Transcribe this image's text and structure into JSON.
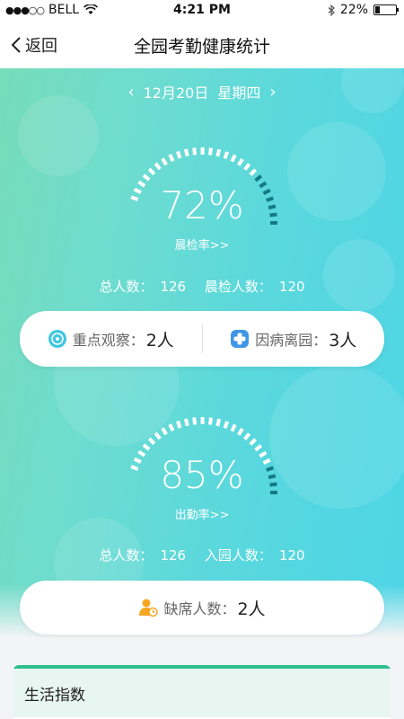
{
  "status_bar": {
    "carrier": "BELL",
    "time": "4:21 PM",
    "battery": "22%",
    "battery_level": 0.22
  },
  "nav": {
    "back_label": "返回",
    "title": "全园考勤健康统计"
  },
  "date": {
    "day": "12月20日",
    "weekday": "星期四"
  },
  "morning_check": {
    "rate": "72%",
    "rate_value": 72,
    "link": "晨检率>>",
    "total_label": "总人数：",
    "total": "126",
    "checked_label": "晨检人数：",
    "checked": "120"
  },
  "observation": {
    "focus_label": "重点观察：",
    "focus_count": "2人",
    "sick_label": "因病离园：",
    "sick_count": "3人"
  },
  "attendance": {
    "rate": "85%",
    "rate_value": 85,
    "link": "出勤率>>",
    "total_label": "总人数：",
    "total": "126",
    "entered_label": "入园人数：",
    "entered": "120"
  },
  "absence": {
    "label": "缺席人数：",
    "count": "2人"
  },
  "life_index": {
    "title": "生活指数"
  },
  "colors": {
    "accent": "#2cbf8d",
    "gauge_dim": "#137a85",
    "hero_left": "#76dcb9",
    "hero_right": "#4dd5e6"
  }
}
